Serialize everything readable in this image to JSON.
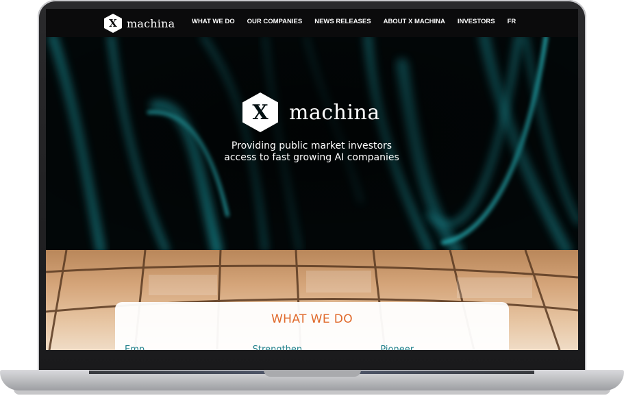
{
  "site": {
    "brand_mark": "X",
    "brand_name": "machina"
  },
  "nav": {
    "items": [
      {
        "label": "WHAT WE DO"
      },
      {
        "label": "OUR COMPANIES"
      },
      {
        "label": "NEWS RELEASES"
      },
      {
        "label": "ABOUT X MACHINA"
      },
      {
        "label": "INVESTORS"
      },
      {
        "label": "FR"
      }
    ]
  },
  "hero": {
    "brand_mark": "X",
    "brand_name": "machina",
    "tagline_line1": "Providing public market investors",
    "tagline_line2": "access to fast growing AI companies"
  },
  "section": {
    "title": "WHAT WE DO",
    "columns": [
      {
        "text": "Emp..."
      },
      {
        "text": "Strengthen..."
      },
      {
        "text": "Pioneer..."
      }
    ]
  },
  "colors": {
    "accent": "#e06a2c",
    "teal_text": "#1f7f8a",
    "nav_bg": "#0b0b0c",
    "glow": "#1fa7b0"
  }
}
